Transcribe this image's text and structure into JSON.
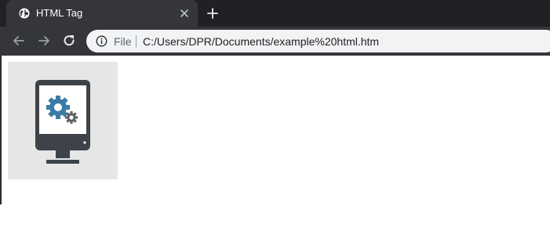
{
  "tab": {
    "title": "HTML Tag",
    "favicon_icon": "globe-icon",
    "close_icon": "close-icon"
  },
  "new_tab_icon": "plus-icon",
  "toolbar": {
    "back_icon": "arrow-left-icon",
    "forward_icon": "arrow-right-icon",
    "reload_icon": "reload-icon"
  },
  "omnibox": {
    "info_icon": "info-icon",
    "scheme_label": "File",
    "url": "C:/Users/DPR/Documents/example%20html.htm"
  },
  "page": {
    "image_icon": "computer-settings-icon"
  },
  "colors": {
    "tabstrip_bg": "#202124",
    "toolbar_bg": "#35363a",
    "omnibox_bg": "#f1f3f4",
    "image_bg": "#e6e6e6",
    "monitor": "#3d4349",
    "gear_blue": "#3a7ca5"
  }
}
